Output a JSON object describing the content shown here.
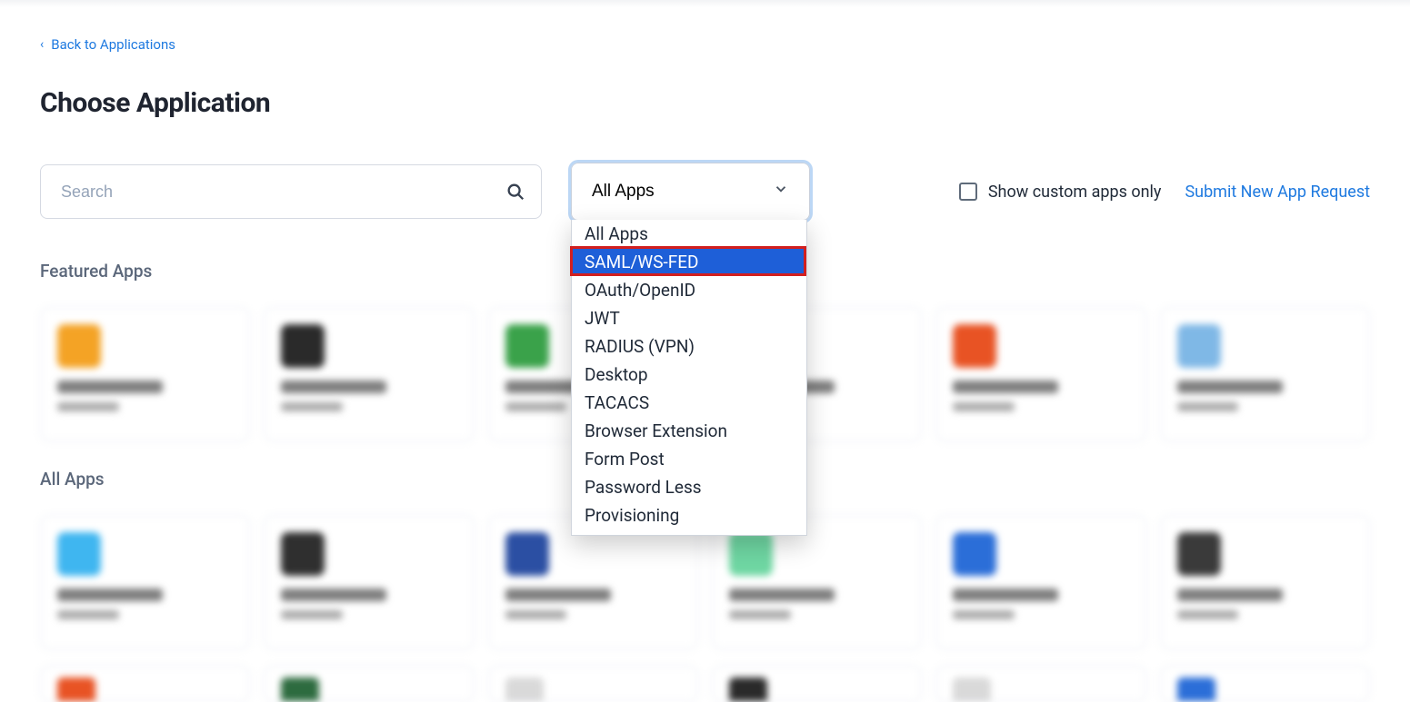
{
  "nav": {
    "back_label": "Back to Applications"
  },
  "page": {
    "title": "Choose Application"
  },
  "search": {
    "placeholder": "Search"
  },
  "filter": {
    "selected_label": "All Apps",
    "options": [
      "All Apps",
      "SAML/WS-FED",
      "OAuth/OpenID",
      "JWT",
      "RADIUS (VPN)",
      "Desktop",
      "TACACS",
      "Browser Extension",
      "Form Post",
      "Password Less",
      "Provisioning"
    ],
    "highlighted_index": 1
  },
  "custom_only": {
    "label": "Show custom apps only",
    "checked": false
  },
  "submit_request": {
    "label": "Submit New App Request"
  },
  "sections": {
    "featured": "Featured Apps",
    "all": "All Apps"
  },
  "featured_apps": [
    {
      "color": "#f4a325"
    },
    {
      "color": "#2a2a2a"
    },
    {
      "color": "#3aa24a"
    },
    {
      "color": "#d9d9d9"
    },
    {
      "color": "#e85324"
    },
    {
      "color": "#7fb8e6"
    }
  ],
  "all_apps": [
    {
      "color": "#3fb6f0"
    },
    {
      "color": "#2f2f2f"
    },
    {
      "color": "#2b4fa3"
    },
    {
      "color": "#6fd7a3"
    },
    {
      "color": "#2b6ed8"
    },
    {
      "color": "#3a3a3a"
    }
  ],
  "partial_apps": [
    {
      "color": "#e85324"
    },
    {
      "color": "#2d6b3f"
    },
    {
      "color": "#d9d9d9"
    },
    {
      "color": "#2a2a2a"
    },
    {
      "color": "#d9d9d9"
    },
    {
      "color": "#2b6ed8"
    }
  ]
}
